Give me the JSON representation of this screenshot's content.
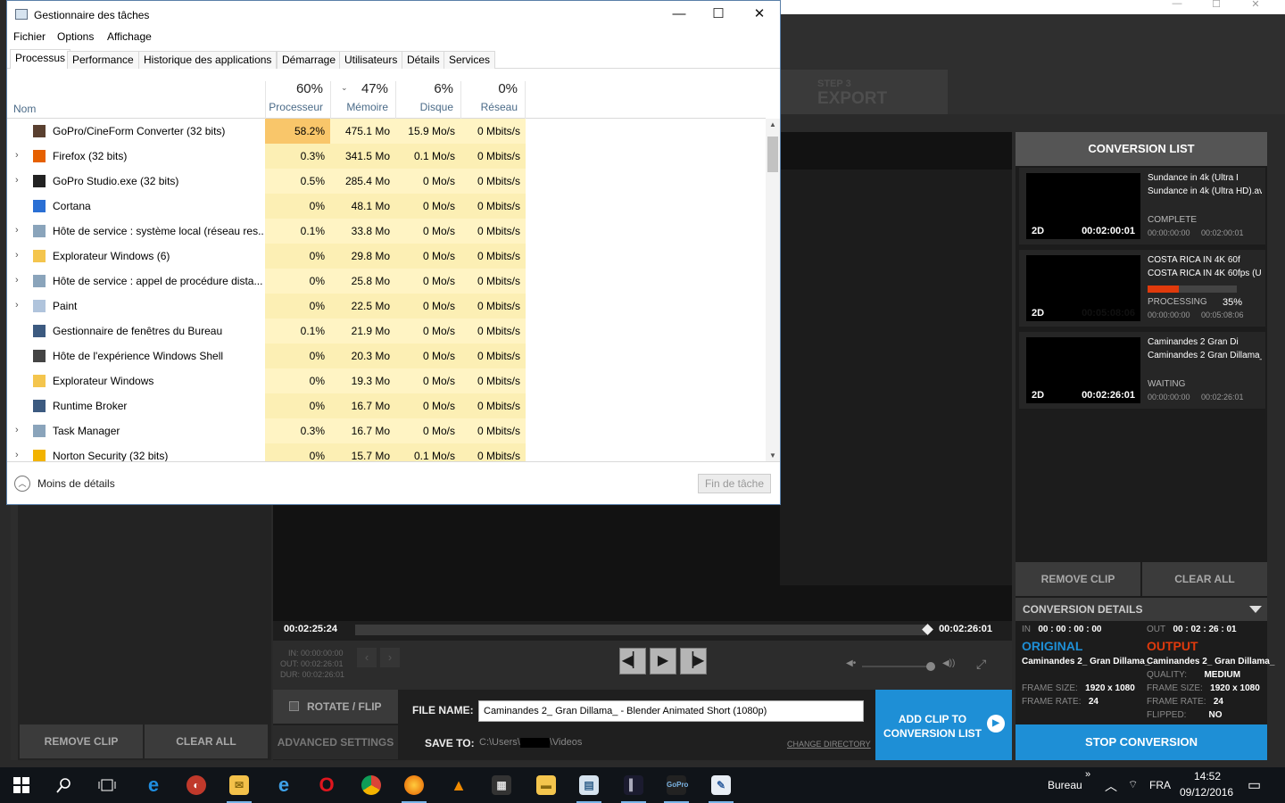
{
  "taskmgr": {
    "title": "Gestionnaire des tâches",
    "controls": {
      "min": "—",
      "max": "☐",
      "close": "✕"
    },
    "menu": [
      "Fichier",
      "Options",
      "Affichage"
    ],
    "tabs": [
      "Processus",
      "Performance",
      "Historique des applications",
      "Démarrage",
      "Utilisateurs",
      "Détails",
      "Services"
    ],
    "columns": {
      "name": "Nom",
      "cpu_pct": "60%",
      "cpu": "Processeur",
      "mem_pct": "47%",
      "mem": "Mémoire",
      "disk_pct": "6%",
      "disk": "Disque",
      "net_pct": "0%",
      "net": "Réseau"
    },
    "rows": [
      {
        "expand": "",
        "name": "GoPro/CineForm Converter (32 bits)",
        "cpu": "58.2%",
        "mem": "475.1 Mo",
        "disk": "15.9 Mo/s",
        "net": "0 Mbits/s"
      },
      {
        "expand": "›",
        "name": "Firefox (32 bits)",
        "cpu": "0.3%",
        "mem": "341.5 Mo",
        "disk": "0.1 Mo/s",
        "net": "0 Mbits/s"
      },
      {
        "expand": "›",
        "name": "GoPro Studio.exe (32 bits)",
        "cpu": "0.5%",
        "mem": "285.4 Mo",
        "disk": "0 Mo/s",
        "net": "0 Mbits/s"
      },
      {
        "expand": "",
        "name": "Cortana",
        "cpu": "0%",
        "mem": "48.1 Mo",
        "disk": "0 Mo/s",
        "net": "0 Mbits/s"
      },
      {
        "expand": "›",
        "name": "Hôte de service : système local (réseau res...",
        "cpu": "0.1%",
        "mem": "33.8 Mo",
        "disk": "0 Mo/s",
        "net": "0 Mbits/s"
      },
      {
        "expand": "›",
        "name": "Explorateur Windows (6)",
        "cpu": "0%",
        "mem": "29.8 Mo",
        "disk": "0 Mo/s",
        "net": "0 Mbits/s"
      },
      {
        "expand": "›",
        "name": "Hôte de service : appel de procédure dista...",
        "cpu": "0%",
        "mem": "25.8 Mo",
        "disk": "0 Mo/s",
        "net": "0 Mbits/s"
      },
      {
        "expand": "›",
        "name": "Paint",
        "cpu": "0%",
        "mem": "22.5 Mo",
        "disk": "0 Mo/s",
        "net": "0 Mbits/s"
      },
      {
        "expand": "",
        "name": "Gestionnaire de fenêtres du Bureau",
        "cpu": "0.1%",
        "mem": "21.9 Mo",
        "disk": "0 Mo/s",
        "net": "0 Mbits/s"
      },
      {
        "expand": "",
        "name": "Hôte de l'expérience Windows Shell",
        "cpu": "0%",
        "mem": "20.3 Mo",
        "disk": "0 Mo/s",
        "net": "0 Mbits/s"
      },
      {
        "expand": "",
        "name": "Explorateur Windows",
        "cpu": "0%",
        "mem": "19.3 Mo",
        "disk": "0 Mo/s",
        "net": "0 Mbits/s"
      },
      {
        "expand": "",
        "name": "Runtime Broker",
        "cpu": "0%",
        "mem": "16.7 Mo",
        "disk": "0 Mo/s",
        "net": "0 Mbits/s"
      },
      {
        "expand": "›",
        "name": "Task Manager",
        "cpu": "0.3%",
        "mem": "16.7 Mo",
        "disk": "0 Mo/s",
        "net": "0 Mbits/s"
      },
      {
        "expand": "›",
        "name": "Norton Security (32 bits)",
        "cpu": "0%",
        "mem": "15.7 Mo",
        "disk": "0.1 Mo/s",
        "net": "0 Mbits/s"
      }
    ],
    "footer": {
      "less": "Moins de détails",
      "end_task": "Fin de tâche"
    },
    "colors": {
      "cpu_hot": "#f9c66a",
      "cell": "#fff4c4",
      "cell_alt": "#fcefb4"
    }
  },
  "gopro": {
    "step": {
      "label": "STEP 3",
      "name": "EXPORT"
    },
    "timeline": {
      "in": "00:02:25:24",
      "out": "00:02:26:01"
    },
    "clip_info": {
      "in": "IN: 00:00:00:00",
      "out": "OUT: 00:02:26:01",
      "dur": "DUR: 00:02:26:01"
    },
    "rotate_flip": "ROTATE / FLIP",
    "advanced": "ADVANCED SETTINGS",
    "file_name_label": "FILE NAME:",
    "file_name": "Caminandes 2_ Gran Dillama_ - Blender Animated Short (1080p)",
    "save_to_label": "SAVE TO:",
    "save_to_a": "C:\\Users\\",
    "save_to_b": "\\Videos",
    "change_dir": "CHANGE DIRECTORY",
    "add_clip": "ADD CLIP TO CONVERSION LIST",
    "left_remove": "REMOVE CLIP",
    "left_clear": "CLEAR ALL",
    "conversion_list": {
      "title": "CONVERSION LIST",
      "clips": [
        {
          "n1": "Sundance in 4k (Ultra I",
          "n2": "Sundance in 4k (Ultra HD).av",
          "status": "COMPLETE",
          "pct": "",
          "t1": "00:00:00:00",
          "t2": "00:02:00:01",
          "tag": "2D",
          "dur": "00:02:00:01",
          "progress": 1.0
        },
        {
          "n1": "COSTA RICA IN 4K 60f",
          "n2": "COSTA RICA IN 4K 60fps (UL",
          "status": "PROCESSING",
          "pct": "35%",
          "t1": "00:00:00:00",
          "t2": "00:05:08:06",
          "tag": "2D",
          "dur": "00:05:08:06",
          "progress": 0.35
        },
        {
          "n1": "Caminandes 2 Gran Di",
          "n2": "Caminandes 2 Gran Dillama_",
          "status": "WAITING",
          "pct": "",
          "t1": "00:00:00:00",
          "t2": "00:02:26:01",
          "tag": "2D",
          "dur": "00:02:26:01",
          "progress": 0
        }
      ],
      "remove": "REMOVE CLIP",
      "clear": "CLEAR ALL"
    },
    "details": {
      "title": "CONVERSION DETAILS",
      "in_label": "IN",
      "in": "00 : 00 : 00 : 00",
      "out_label": "OUT",
      "out": "00 : 02 : 26 : 01",
      "original": "ORIGINAL",
      "output": "OUTPUT",
      "orig_name": "Caminandes 2_ Gran Dillama_",
      "out_name": "Caminandes 2_ Gran Dillama_",
      "quality_label": "QUALITY:",
      "quality": "MEDIUM",
      "frame_size_label": "FRAME SIZE:",
      "orig_frame_size": "1920 x 1080",
      "out_frame_size": "1920 x 1080",
      "frame_rate_label": "FRAME RATE:",
      "orig_frame_rate": "24",
      "out_frame_rate": "24",
      "flipped_label": "FLIPPED:",
      "flipped": "NO"
    },
    "stop": "STOP CONVERSION",
    "colors": {
      "blue": "#1e8fd6",
      "orange": "#e03a0c"
    }
  },
  "taskbar": {
    "apps": [
      "start-icon",
      "search-icon",
      "task-view-icon",
      "edge-icon",
      "app-icon",
      "mail-icon",
      "ie-icon",
      "opera-icon",
      "chrome-icon",
      "firefox-icon",
      "vlc-icon",
      "video-editor-icon",
      "file-explorer-icon",
      "task-manager-icon",
      "app-icon",
      "gopro-icon",
      "paint-icon"
    ],
    "bureau": "Bureau",
    "lang": "FRA",
    "time": "14:52",
    "date": "09/12/2016"
  }
}
